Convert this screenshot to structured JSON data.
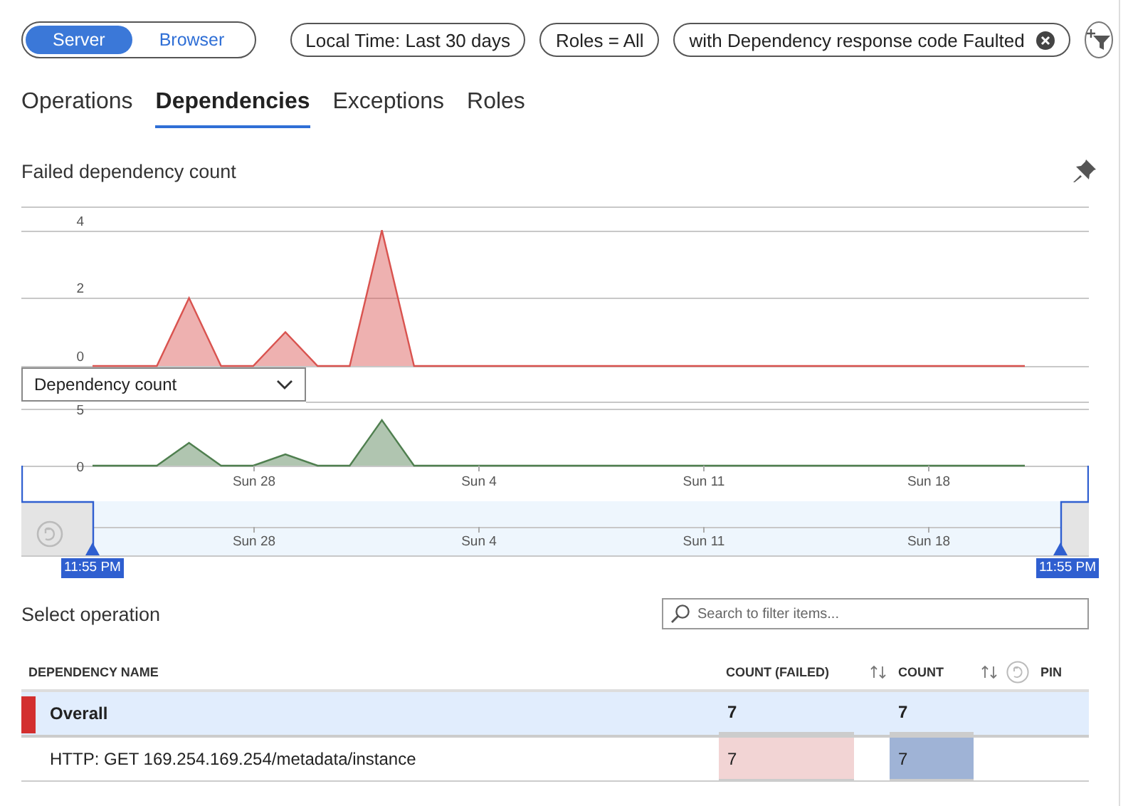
{
  "scope_toggle": [
    {
      "label": "Server",
      "selected": true
    },
    {
      "label": "Browser",
      "selected": false
    }
  ],
  "filters": [
    {
      "label": "Local Time: Last 30 days",
      "removable": false
    },
    {
      "label": "Roles = All",
      "removable": false
    },
    {
      "label": "with Dependency response code Faulted",
      "removable": true
    }
  ],
  "tabs": [
    {
      "label": "Operations",
      "selected": false
    },
    {
      "label": "Dependencies",
      "selected": true
    },
    {
      "label": "Exceptions",
      "selected": false
    },
    {
      "label": "Roles",
      "selected": false
    }
  ],
  "chart_panel": {
    "chart_data": {
      "type": "area",
      "title": "Failed dependency count",
      "categories": [
        null,
        null,
        null,
        null,
        null,
        null,
        null,
        null,
        null,
        null,
        null,
        null,
        null,
        null,
        null,
        null,
        null,
        null,
        null,
        null,
        null,
        null,
        null,
        null,
        null,
        null,
        null,
        null,
        null,
        null
      ],
      "ylim": [
        0,
        4.7
      ],
      "yticks": [
        0,
        2,
        4
      ],
      "series": [
        {
          "color": "#d9534f",
          "values": [
            0,
            0,
            0,
            2,
            0,
            0,
            1,
            0,
            0,
            4,
            0,
            0,
            0,
            0,
            0,
            0,
            0,
            0,
            0,
            0,
            0,
            0,
            0,
            0,
            0,
            0,
            0,
            0,
            0,
            0
          ]
        }
      ]
    }
  },
  "metric_dropdown": {
    "value": "Dependency count"
  },
  "secondary_chart": {
    "chart_data": {
      "type": "area",
      "ylim": [
        0,
        5
      ],
      "yticks": [
        0,
        5
      ],
      "categories": [
        null,
        null,
        null,
        null,
        null,
        "Sun 28",
        null,
        null,
        null,
        null,
        null,
        null,
        "Sun 4",
        null,
        null,
        null,
        null,
        null,
        null,
        "Sun 11",
        null,
        null,
        null,
        null,
        null,
        null,
        "Sun 18",
        null,
        null,
        null
      ],
      "series": [
        {
          "color": "#4f7f4f",
          "values": [
            0,
            0,
            0,
            2,
            0,
            0,
            1,
            0,
            0,
            4,
            0,
            0,
            0,
            0,
            0,
            0,
            0,
            0,
            0,
            0,
            0,
            0,
            0,
            0,
            0,
            0,
            0,
            0,
            0,
            0
          ]
        }
      ]
    }
  },
  "time_brush": {
    "ticks": [
      "Sun 28",
      "Sun 4",
      "Sun 11",
      "Sun 18"
    ],
    "start_label": "11:55 PM",
    "end_label": "11:55 PM"
  },
  "operations": {
    "title": "Select operation",
    "search": {
      "placeholder": "Search to filter items..."
    },
    "columns": [
      "DEPENDENCY NAME",
      "COUNT (FAILED)",
      "COUNT",
      "PIN"
    ],
    "rows": [
      {
        "name": "Overall",
        "count_failed": "7",
        "count": "7",
        "selected": true
      },
      {
        "name": "HTTP: GET 169.254.169.254/metadata/instance",
        "count_failed": "7",
        "count": "7",
        "selected": false
      }
    ]
  }
}
